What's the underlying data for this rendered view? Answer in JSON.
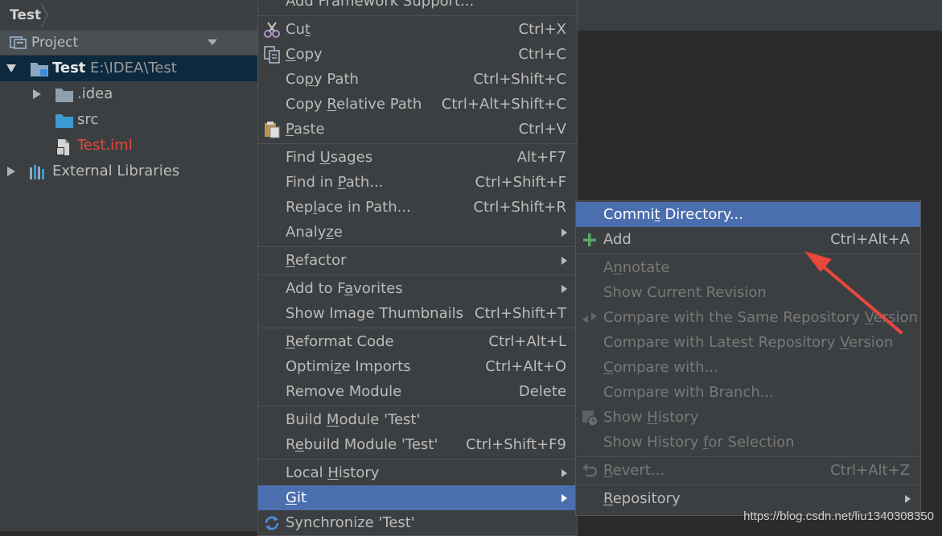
{
  "nav": {
    "breadcrumb": "Test"
  },
  "project_panel": {
    "title": "Project",
    "tree": {
      "root": {
        "name": "Test",
        "path": "E:\\IDEA\\Test"
      },
      "idea": ".idea",
      "src": "src",
      "iml": "Test.iml",
      "libs": "External Libraries"
    }
  },
  "context_menu": {
    "top_partial": "Add Framework Support...",
    "cut": {
      "a": "Cu",
      "m": "t",
      "b": "",
      "sc": "Ctrl+X"
    },
    "copy": {
      "a": "",
      "m": "C",
      "b": "opy",
      "sc": "Ctrl+C"
    },
    "copy_path": {
      "a": "Co",
      "m": "p",
      "b": "y Path",
      "sc": "Ctrl+Shift+C"
    },
    "copy_rel": {
      "a": "Copy ",
      "m": "R",
      "b": "elative Path",
      "sc": "Ctrl+Alt+Shift+C"
    },
    "paste": {
      "a": "",
      "m": "P",
      "b": "aste",
      "sc": "Ctrl+V"
    },
    "find_usages": {
      "a": "Find ",
      "m": "U",
      "b": "sages",
      "sc": "Alt+F7"
    },
    "find_path": {
      "a": "Find in ",
      "m": "P",
      "b": "ath...",
      "sc": "Ctrl+Shift+F"
    },
    "replace": {
      "a": "Rep",
      "m": "l",
      "b": "ace in Path...",
      "sc": "Ctrl+Shift+R"
    },
    "analyze": {
      "a": "Analy",
      "m": "z",
      "b": "e"
    },
    "refactor": {
      "a": "",
      "m": "R",
      "b": "efactor"
    },
    "favorites": {
      "a": "Add to F",
      "m": "a",
      "b": "vorites"
    },
    "thumbnails": {
      "label": "Show Image Thumbnails",
      "sc": "Ctrl+Shift+T"
    },
    "reformat": {
      "a": "",
      "m": "R",
      "b": "eformat Code",
      "sc": "Ctrl+Alt+L"
    },
    "optimize": {
      "a": "Optimi",
      "m": "z",
      "b": "e Imports",
      "sc": "Ctrl+Alt+O"
    },
    "remove": {
      "label": "Remove Module",
      "sc": "Delete"
    },
    "build": {
      "a": "Build ",
      "m": "M",
      "b": "odule 'Test'"
    },
    "rebuild": {
      "a": "R",
      "m": "e",
      "b": "build Module 'Test'",
      "sc": "Ctrl+Shift+F9"
    },
    "local_hist": {
      "a": "Local ",
      "m": "H",
      "b": "istory"
    },
    "git": {
      "a": "",
      "m": "G",
      "b": "it"
    },
    "sync": {
      "label": "Synchronize 'Test'"
    }
  },
  "git_menu": {
    "commit": {
      "a": "Commi",
      "m": "t",
      "b": " Directory..."
    },
    "add": {
      "label": "Add",
      "sc": "Ctrl+Alt+A"
    },
    "annotate": {
      "a": "A",
      "m": "n",
      "b": "notate"
    },
    "show_rev": {
      "label": "Show Current Revision"
    },
    "cmp_same": {
      "a": "Compare with the Same Repository ",
      "m": "V",
      "b": "ersion"
    },
    "cmp_latest": {
      "a": "Compare with Latest Repository ",
      "m": "V",
      "b": "ersion"
    },
    "cmp_with": {
      "a": "",
      "m": "C",
      "b": "ompare with..."
    },
    "cmp_branch": {
      "label": "Compare with Branch..."
    },
    "show_hist": {
      "a": "Show ",
      "m": "H",
      "b": "istory"
    },
    "hist_sel": {
      "a": "Show History ",
      "m": "f",
      "b": "or Selection"
    },
    "revert": {
      "a": "",
      "m": "R",
      "b": "evert...",
      "sc": "Ctrl+Alt+Z"
    },
    "repository": {
      "a": "",
      "m": "R",
      "b": "epository"
    }
  },
  "colors": {
    "selection": "#4b6eaf",
    "accent_red": "#e8473c",
    "add_green": "#59a869"
  },
  "watermark": "https://blog.csdn.net/liu1340308350"
}
